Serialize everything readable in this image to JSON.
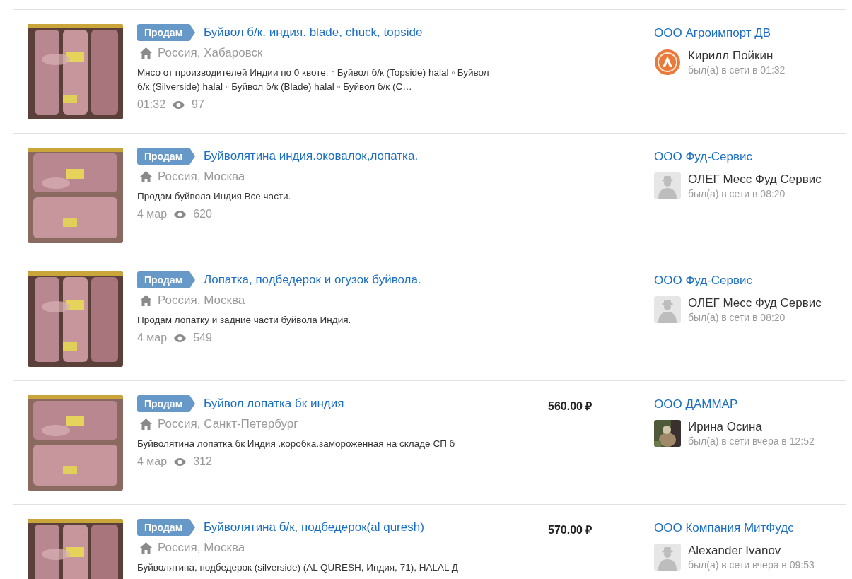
{
  "listings": [
    {
      "badge": "Продам",
      "title": "Буйвол б/к. индия. blade, chuck, topside",
      "location": "Россия, Хабаровск",
      "description": "Мясо от производителей Индии по 0 квоте: ◦ Буйвол б/к (Topside) halal ◦ Буйвол б/к (Silverside) halal ◦ Буйвол б/к (Blade) halal ◦ Буйвол б/к (C…",
      "date": "01:32",
      "views": "97",
      "company": "ООО Агроимпорт ДВ",
      "seller": "Кирилл Пойкин",
      "last_seen": "был(а) в сети в 01:32",
      "avatar": {
        "kind": "logo"
      }
    },
    {
      "badge": "Продам",
      "title": "Буйволятина индия.оковалок,лопатка.",
      "location": "Россия, Москва",
      "description": "Продам буйвола Индия.Все части.",
      "date": "4 мар",
      "views": "620",
      "company": "ООО Фуд-Сервис",
      "seller": "ОЛЕГ Месс Фуд Сервис",
      "last_seen": "был(а) в сети в 08:20",
      "avatar": {
        "kind": "silhouette"
      }
    },
    {
      "badge": "Продам",
      "title": "Лопатка, подбедерок и огузок буйвола.",
      "location": "Россия, Москва",
      "description": "Продам лопатку и задние части буйвола Индия.",
      "date": "4 мар",
      "views": "549",
      "company": "ООО Фуд-Сервис",
      "seller": "ОЛЕГ Месс Фуд Сервис",
      "last_seen": "был(а) в сети в 08:20",
      "avatar": {
        "kind": "silhouette"
      }
    },
    {
      "badge": "Продам",
      "title": "Буйвол лопатка бк индия",
      "location": "Россия, Санкт-Петербург",
      "description": "Буйволятина лопатка бк Индия .коробка.замороженная на складе СП б",
      "date": "4 мар",
      "views": "312",
      "price": "560.00 ₽",
      "company": "ООО ДАММАР",
      "seller": "Ирина Осина",
      "last_seen": "был(а) в сети вчера в 12:52"
    },
    {
      "badge": "Продам",
      "title": "Буйволятина б/к, подбедерок(al quresh)",
      "location": "Россия, Москва",
      "description": "Буйволятина, подбедерок (silverside) (AL QURESH, Индия, 71), HALAL Д",
      "price": "570.00 ₽",
      "company": "ООО Компания МитФудс",
      "seller": "Alexander Ivanov",
      "last_seen": "был(а) в сети вчера в 09:53",
      "avatar": {
        "kind": "silhouette"
      }
    }
  ]
}
